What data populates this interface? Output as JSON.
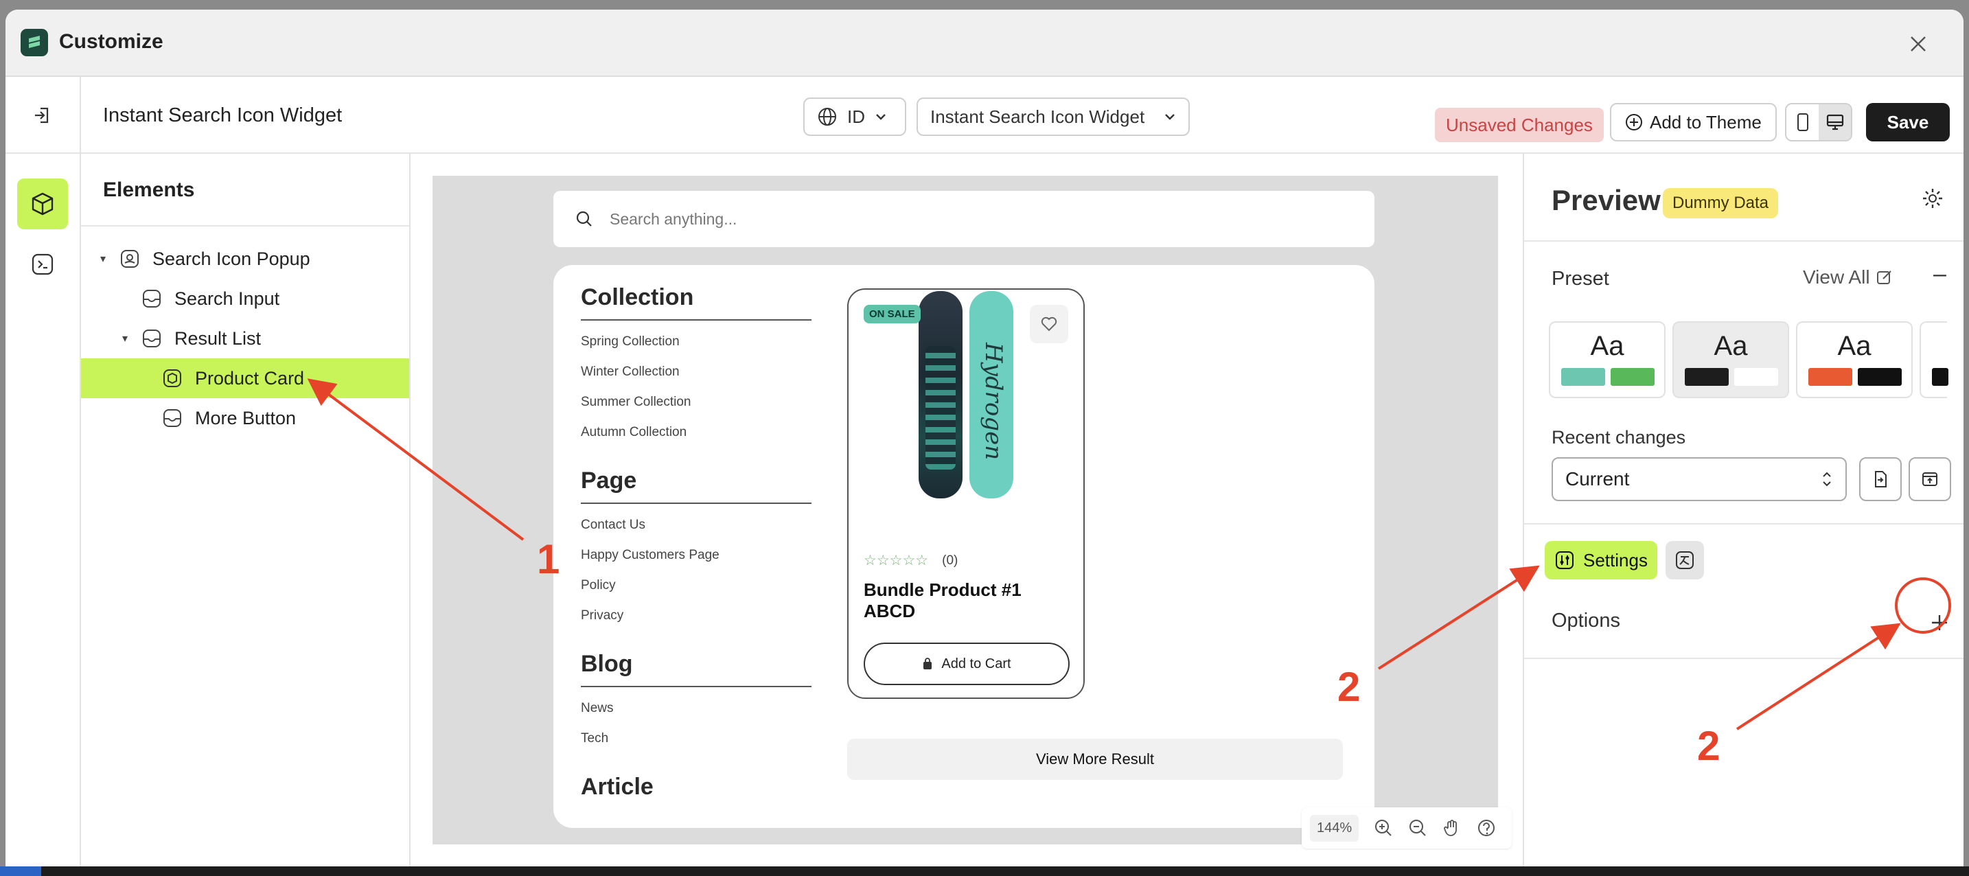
{
  "window": {
    "title": "Customize"
  },
  "header": {
    "widget_name": "Instant Search Icon Widget",
    "language": "ID",
    "widget_selector": "Instant Search Icon Widget",
    "unsaved": "Unsaved Changes",
    "add_to_theme": "Add to Theme",
    "save": "Save"
  },
  "elements": {
    "title": "Elements",
    "tree": [
      {
        "label": "Search Icon Popup"
      },
      {
        "label": "Search Input"
      },
      {
        "label": "Result List"
      },
      {
        "label": "Product Card"
      },
      {
        "label": "More Button"
      }
    ]
  },
  "canvas": {
    "search_placeholder": "Search anything...",
    "categories": [
      {
        "heading": "Collection",
        "links": [
          "Spring Collection",
          "Winter Collection",
          "Summer Collection",
          "Autumn Collection"
        ]
      },
      {
        "heading": "Page",
        "links": [
          "Contact Us",
          "Happy Customers Page",
          "Policy",
          "Privacy"
        ]
      },
      {
        "heading": "Blog",
        "links": [
          "News",
          "Tech"
        ]
      },
      {
        "heading": "Article",
        "links": []
      }
    ],
    "product": {
      "badge": "ON SALE",
      "board_text": "Hydrogen",
      "stars": "☆☆☆☆☆",
      "review_count": "(0)",
      "title": "Bundle Product #1 ABCD",
      "cart_label": "Add to Cart"
    },
    "more_button": "View More Result",
    "zoom": "144%"
  },
  "right": {
    "title": "Preview",
    "badge": "Dummy Data",
    "preset_label": "Preset",
    "view_all": "View All",
    "presets": [
      {
        "label": "Aa",
        "colors": [
          "#6cc6b0",
          "#58b85a"
        ]
      },
      {
        "label": "Aa",
        "colors": [
          "#1d1d1d",
          "#ffffff"
        ]
      },
      {
        "label": "Aa",
        "colors": [
          "#e85a32",
          "#111111"
        ]
      }
    ],
    "recent_label": "Recent changes",
    "recent_value": "Current",
    "settings_tab": "Settings",
    "options_label": "Options"
  },
  "annotations": {
    "one": "1",
    "two_a": "2",
    "two_b": "2"
  },
  "colors": {
    "accent": "#c8f45a",
    "annotation": "#e5432a"
  }
}
